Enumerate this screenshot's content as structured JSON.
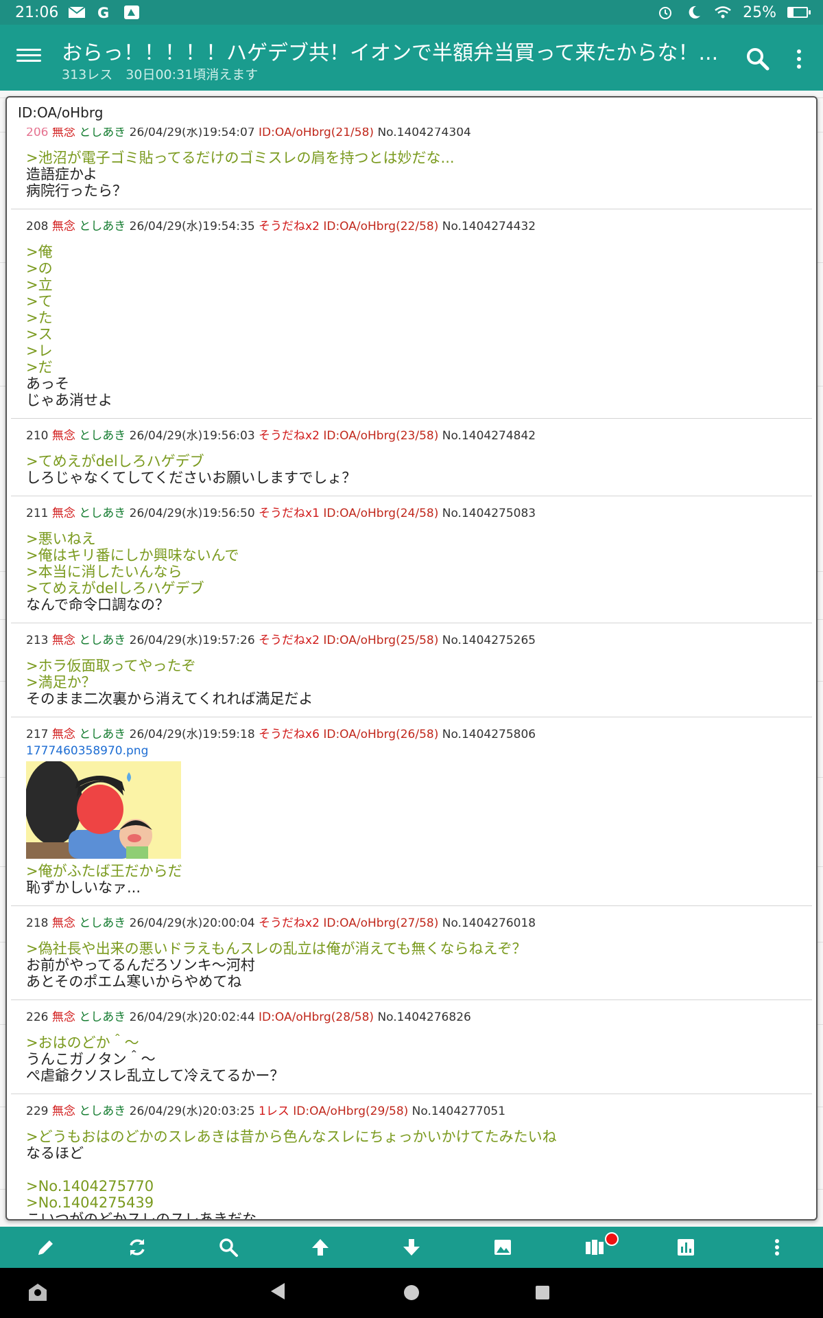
{
  "status": {
    "time": "21:06",
    "battery": "25%",
    "icons": [
      "mail-icon",
      "google-icon",
      "app-icon",
      "alarm-icon",
      "moon-icon",
      "wifi-icon",
      "battery-icon"
    ]
  },
  "appbar": {
    "title": "おらっ！！！！！ハゲデブ共！イオンで半額弁当買って来たからな！...",
    "subtitle": "313レス　30日00:31頃消えます"
  },
  "popup": {
    "header": "ID:OA/oHbrg",
    "posts": [
      {
        "num": "206",
        "label": "無念",
        "name": "としあき",
        "date": "26/04/29(水)19:54:07",
        "soudane": "",
        "id": "ID:OA/oHbrg(21/58)",
        "no": "No.1404274304",
        "lines": [
          {
            "q": true,
            "text": ">池沼が電子ゴミ貼ってるだけのゴミスレの肩を持つとは妙だな..."
          },
          {
            "q": false,
            "text": "造語症かよ"
          },
          {
            "q": false,
            "text": "病院行ったら？"
          }
        ]
      },
      {
        "num": "208",
        "label": "無念",
        "name": "としあき",
        "date": "26/04/29(水)19:54:35",
        "soudane": "そうだねx2",
        "id": "ID:OA/oHbrg(22/58)",
        "no": "No.1404274432",
        "lines": [
          {
            "q": true,
            "text": ">俺"
          },
          {
            "q": true,
            "text": ">の"
          },
          {
            "q": true,
            "text": ">立"
          },
          {
            "q": true,
            "text": ">て"
          },
          {
            "q": true,
            "text": ">た"
          },
          {
            "q": true,
            "text": ">ス"
          },
          {
            "q": true,
            "text": ">レ"
          },
          {
            "q": true,
            "text": ">だ"
          },
          {
            "q": false,
            "text": "あっそ"
          },
          {
            "q": false,
            "text": "じゃあ消せよ"
          }
        ]
      },
      {
        "num": "210",
        "label": "無念",
        "name": "としあき",
        "date": "26/04/29(水)19:56:03",
        "soudane": "そうだねx2",
        "id": "ID:OA/oHbrg(23/58)",
        "no": "No.1404274842",
        "lines": [
          {
            "q": true,
            "text": ">てめえがdelしろハゲデブ"
          },
          {
            "q": false,
            "text": "しろじゃなくてしてくださいお願いしますでしょ？"
          }
        ]
      },
      {
        "num": "211",
        "label": "無念",
        "name": "としあき",
        "date": "26/04/29(水)19:56:50",
        "soudane": "そうだねx1",
        "id": "ID:OA/oHbrg(24/58)",
        "no": "No.1404275083",
        "lines": [
          {
            "q": true,
            "text": ">悪いねえ"
          },
          {
            "q": true,
            "text": ">俺はキリ番にしか興味ないんで"
          },
          {
            "q": true,
            "text": ">本当に消したいんなら"
          },
          {
            "q": true,
            "text": ">てめえがdelしろハゲデブ"
          },
          {
            "q": false,
            "text": "なんで命令口調なの？"
          }
        ]
      },
      {
        "num": "213",
        "label": "無念",
        "name": "としあき",
        "date": "26/04/29(水)19:57:26",
        "soudane": "そうだねx2",
        "id": "ID:OA/oHbrg(25/58)",
        "no": "No.1404275265",
        "lines": [
          {
            "q": true,
            "text": ">ホラ仮面取ってやったぞ"
          },
          {
            "q": true,
            "text": ">満足か？"
          },
          {
            "q": false,
            "text": "そのまま二次裏から消えてくれれば満足だよ"
          }
        ]
      },
      {
        "num": "217",
        "label": "無念",
        "name": "としあき",
        "date": "26/04/29(水)19:59:18",
        "soudane": "そうだねx6",
        "id": "ID:OA/oHbrg(26/58)",
        "no": "No.1404275806",
        "file": "1777460358970.png",
        "lines": [
          {
            "q": true,
            "text": ">俺がふたば王だからだ"
          },
          {
            "q": false,
            "text": "恥ずかしいなァ..."
          }
        ]
      },
      {
        "num": "218",
        "label": "無念",
        "name": "としあき",
        "date": "26/04/29(水)20:00:04",
        "soudane": "そうだねx2",
        "id": "ID:OA/oHbrg(27/58)",
        "no": "No.1404276018",
        "lines": [
          {
            "q": true,
            "text": ">偽社長や出来の悪いドラえもんスレの乱立は俺が消えても無くならねえぞ？"
          },
          {
            "q": false,
            "text": "お前がやってるんだろソンキ〜河村"
          },
          {
            "q": false,
            "text": "あとそのポエム寒いからやめてね"
          }
        ]
      },
      {
        "num": "226",
        "label": "無念",
        "name": "としあき",
        "date": "26/04/29(水)20:02:44",
        "soudane": "",
        "id": "ID:OA/oHbrg(28/58)",
        "no": "No.1404276826",
        "lines": [
          {
            "q": true,
            "text": ">おはのどか＾〜"
          },
          {
            "q": false,
            "text": "うんこガノタン＾〜"
          },
          {
            "q": false,
            "text": "ぺ虐爺クソスレ乱立して冷えてるかー？"
          }
        ]
      },
      {
        "num": "229",
        "label": "無念",
        "name": "としあき",
        "date": "26/04/29(水)20:03:25",
        "soudane": "1レス",
        "id": "ID:OA/oHbrg(29/58)",
        "no": "No.1404277051",
        "lines": [
          {
            "q": true,
            "text": ">どうもおはのどかのスレあきは昔から色んなスレにちょっかいかけてたみたいね"
          },
          {
            "q": false,
            "text": "なるほど"
          },
          {
            "q": false,
            "text": ""
          },
          {
            "q": true,
            "text": ">No.1404275770"
          },
          {
            "q": true,
            "text": ">No.1404275439"
          },
          {
            "q": false,
            "text": "こいつがのどかスレのスレあきだな"
          }
        ]
      }
    ]
  },
  "toolbar": {
    "items": [
      "pencil-icon",
      "refresh-icon",
      "search-icon",
      "arrow-up-icon",
      "arrow-down-icon",
      "image-icon",
      "catalog-icon",
      "chart-icon",
      "more-icon"
    ]
  },
  "colors": {
    "appbar": "#1a9c8e",
    "statusbar": "#1e8f83",
    "quote": "#7a9a1e",
    "name": "#117a2d",
    "muken": "#d11a1a",
    "id": "#c0281c",
    "link": "#1d6dd3"
  }
}
